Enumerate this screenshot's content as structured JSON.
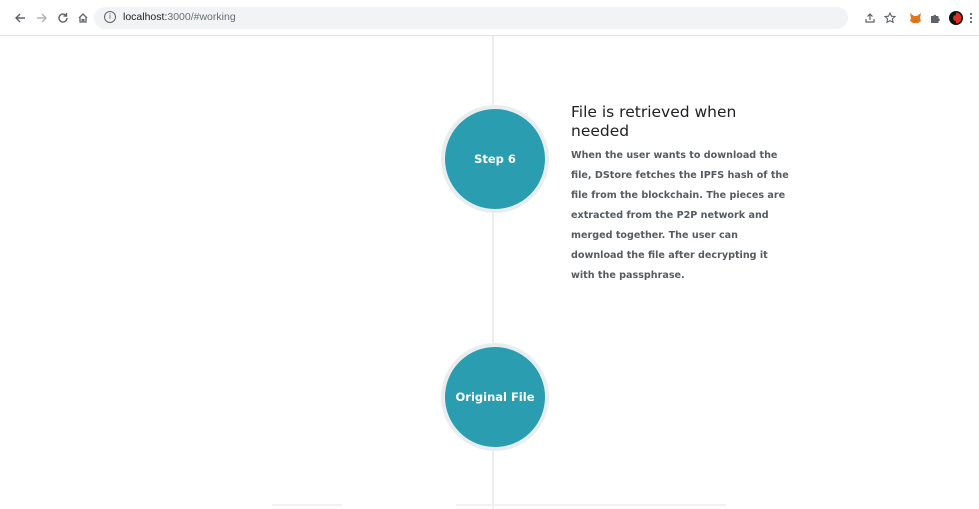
{
  "browser": {
    "back_icon": "arrow-left",
    "forward_icon": "arrow-right",
    "reload_icon": "reload",
    "home_icon": "home",
    "url_host": "localhost:",
    "url_path": "3000/#working",
    "site_info_icon": "info"
  },
  "timeline": {
    "step_circle_label": "Step 6",
    "step_title": "File is retrieved when needed",
    "step_description": "When the user wants to download the file, DStore fetches the IPFS hash of the file from the blockchain. The pieces are extracted from the P2P network and merged together. The user can download the file after decrypting it with the passphrase.",
    "final_circle_label": "Original File",
    "accent_color": "#2b9db1"
  }
}
